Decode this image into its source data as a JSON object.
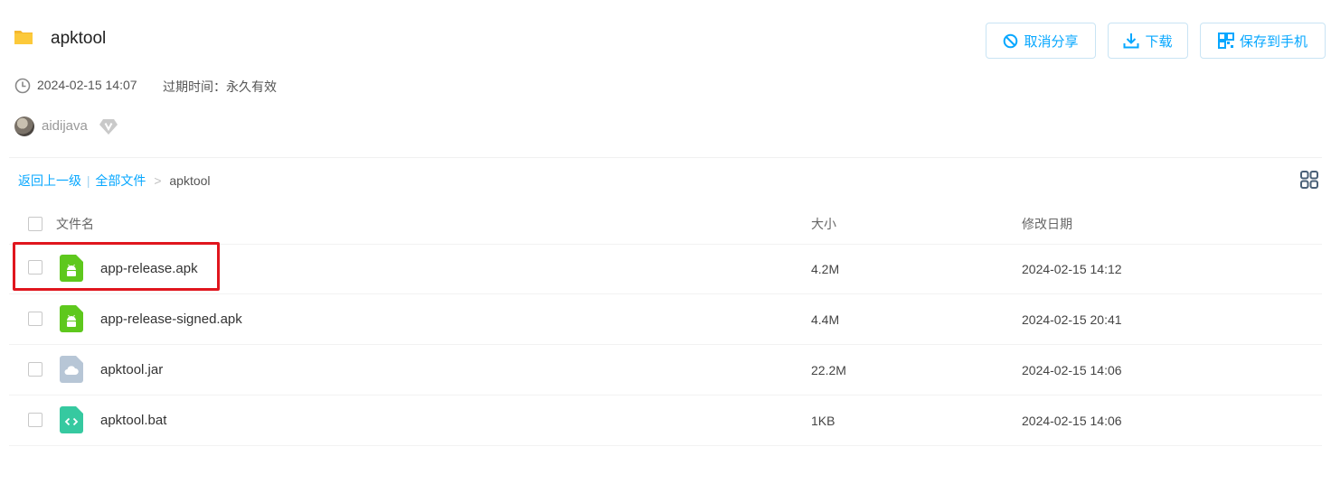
{
  "header": {
    "title": "apktool",
    "buttons": {
      "cancel_share": "取消分享",
      "download": "下载",
      "save_to_phone": "保存到手机"
    }
  },
  "meta": {
    "date": "2024-02-15 14:07",
    "expiry": "过期时间：永久有效"
  },
  "user": {
    "name": "aidijava"
  },
  "breadcrumb": {
    "back": "返回上一级",
    "sep_bar": "|",
    "all_files": "全部文件",
    "sep_arrow": ">",
    "current": "apktool"
  },
  "table": {
    "columns": {
      "name": "文件名",
      "size": "大小",
      "date": "修改日期"
    },
    "rows": [
      {
        "name": "app-release.apk",
        "size": "4.2M",
        "date": "2024-02-15 14:12",
        "icon": "android-apk-icon"
      },
      {
        "name": "app-release-signed.apk",
        "size": "4.4M",
        "date": "2024-02-15 20:41",
        "icon": "android-apk-icon"
      },
      {
        "name": "apktool.jar",
        "size": "22.2M",
        "date": "2024-02-15 14:06",
        "icon": "cloud-file-icon"
      },
      {
        "name": "apktool.bat",
        "size": "1KB",
        "date": "2024-02-15 14:06",
        "icon": "code-file-icon"
      }
    ]
  },
  "colors": {
    "accent": "#06a7ff",
    "highlight_border": "#e0161e",
    "android_green": "#5ec81d",
    "code_teal": "#36c9a0",
    "cloud_gray": "#b7c6d6"
  }
}
